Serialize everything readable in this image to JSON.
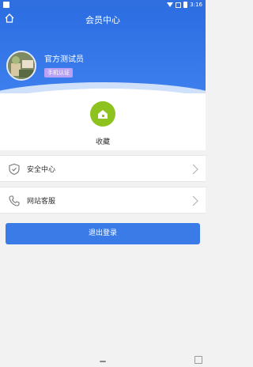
{
  "status_bar": {
    "time": "3:16"
  },
  "header": {
    "title": "会员中心",
    "home_icon": "home-icon"
  },
  "profile": {
    "name": "官方测试员",
    "badge": "手机认证"
  },
  "favorites": {
    "label": "收藏",
    "icon": "house-icon",
    "color": "#8ec21f"
  },
  "menu": [
    {
      "label": "安全中心",
      "icon": "shield-icon"
    },
    {
      "label": "网站客服",
      "icon": "phone-icon"
    }
  ],
  "logout_button": {
    "label": "退出登录",
    "color": "#3a7be8"
  },
  "colors": {
    "brand": "#2f6fe0",
    "badge": "#b9a1f5"
  }
}
